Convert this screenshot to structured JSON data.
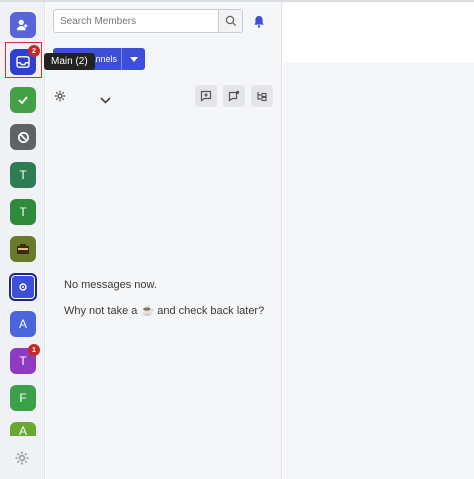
{
  "rail": {
    "tooltip": "Main (2)",
    "items": [
      {
        "name": "members",
        "icon": "user-group-icon",
        "color": "#5865d8"
      },
      {
        "name": "main",
        "icon": "inbox-icon",
        "color": "#2f3fd0",
        "badge": "2"
      },
      {
        "name": "check",
        "icon": "check-icon",
        "color": "#43a047"
      },
      {
        "name": "blocked",
        "icon": "block-icon",
        "color": "#5f6368"
      },
      {
        "name": "t1",
        "letter": "T",
        "color": "#2e7d52"
      },
      {
        "name": "t2",
        "letter": "T",
        "color": "#2e8b3a"
      },
      {
        "name": "image-channel",
        "icon": "image-icon",
        "color": "#6b7a2a"
      },
      {
        "name": "gear-channel",
        "icon": "gear-icon",
        "color": "#3d4fd6"
      },
      {
        "name": "a1",
        "letter": "A",
        "color": "#4a66dd"
      },
      {
        "name": "t3",
        "letter": "T",
        "color": "#8e3bc2",
        "badge": "1"
      },
      {
        "name": "f1",
        "letter": "F",
        "color": "#3aa14a"
      },
      {
        "name": "a2",
        "letter": "A",
        "color": "#6aa834"
      }
    ],
    "settings_icon": "gear-icon"
  },
  "panel": {
    "search_placeholder": "Search Members",
    "channels_button": "Channels",
    "empty_line1": "No messages now.",
    "empty_line2_prefix": "Why not take a",
    "empty_line2_emoji": "☕",
    "empty_line2_suffix": "and check back later?"
  },
  "colors": {
    "accent": "#3d4fd6",
    "badge": "#c62828"
  }
}
